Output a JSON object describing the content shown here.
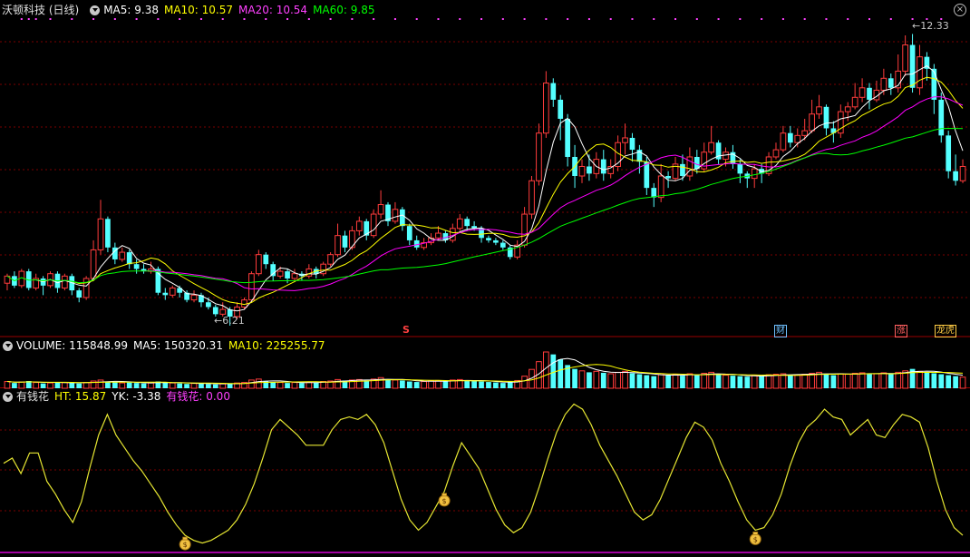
{
  "header": {
    "title": "沃顿科技 (日线)",
    "ma5_label": "MA5: 9.38",
    "ma10_label": "MA10: 10.57",
    "ma20_label": "MA20: 10.54",
    "ma60_label": "MA60: 9.85"
  },
  "volume_header": {
    "label": "VOLUME: 115848.99",
    "ma5_label": "MA5: 150320.31",
    "ma10_label": "MA10: 225255.77"
  },
  "indicator_header": {
    "title": "有钱花",
    "ht_label": "HT: 15.87",
    "yk_label": "YK: -3.38",
    "yqh_label": "有钱花: 0.00"
  },
  "annotations": {
    "high_label": "12.33",
    "low_label": "6.21",
    "badge_cai": "财",
    "badge_zhang": "涨",
    "badge_longhu": "龙虎",
    "s_marker": "S"
  },
  "colors": {
    "up": "#ff3c3c",
    "down": "#54ffff",
    "ma5": "#ffffff",
    "ma10": "#ffff00",
    "ma20": "#ff00ff",
    "ma60": "#00ff00",
    "grid": "#7a0000",
    "indicator": "#e6e632"
  },
  "chart_data": [
    {
      "type": "candlestick",
      "price_range": [
        6.0,
        12.7
      ],
      "candles": [
        [
          7.1,
          7.25,
          7.3,
          6.95
        ],
        [
          7.25,
          7.05,
          7.35,
          7.0
        ],
        [
          7.05,
          7.35,
          7.4,
          7.0
        ],
        [
          7.35,
          7.0,
          7.4,
          6.95
        ],
        [
          7.0,
          7.2,
          7.3,
          6.95
        ],
        [
          7.2,
          7.05,
          7.25,
          6.85
        ],
        [
          7.05,
          7.3,
          7.35,
          7.0
        ],
        [
          7.3,
          7.0,
          7.35,
          6.9
        ],
        [
          7.0,
          7.25,
          7.3,
          6.95
        ],
        [
          7.25,
          6.95,
          7.3,
          6.85
        ],
        [
          6.95,
          6.8,
          7.0,
          6.7
        ],
        [
          6.8,
          7.2,
          7.25,
          6.75
        ],
        [
          7.2,
          7.8,
          8.0,
          7.15
        ],
        [
          7.8,
          8.45,
          8.85,
          7.7
        ],
        [
          8.45,
          7.85,
          8.5,
          7.75
        ],
        [
          7.85,
          7.6,
          7.95,
          7.5
        ],
        [
          7.6,
          7.75,
          7.85,
          7.55
        ],
        [
          7.75,
          7.5,
          7.8,
          7.4
        ],
        [
          7.5,
          7.4,
          7.6,
          7.3
        ],
        [
          7.4,
          7.35,
          7.5,
          7.3
        ],
        [
          7.35,
          7.4,
          7.55,
          7.3
        ],
        [
          7.4,
          6.9,
          7.45,
          6.85
        ],
        [
          6.9,
          6.85,
          7.0,
          6.75
        ],
        [
          6.85,
          7.0,
          7.05,
          6.8
        ],
        [
          7.0,
          6.9,
          7.05,
          6.8
        ],
        [
          6.9,
          6.75,
          6.95,
          6.7
        ],
        [
          6.75,
          6.85,
          6.95,
          6.7
        ],
        [
          6.85,
          6.7,
          6.9,
          6.6
        ],
        [
          6.7,
          6.6,
          6.8,
          6.55
        ],
        [
          6.6,
          6.45,
          6.65,
          6.4
        ],
        [
          6.45,
          6.55,
          6.7,
          6.4
        ],
        [
          6.55,
          6.4,
          6.6,
          6.21
        ],
        [
          6.4,
          6.6,
          6.7,
          6.35
        ],
        [
          6.6,
          6.75,
          6.8,
          6.55
        ],
        [
          6.75,
          7.3,
          7.35,
          6.7
        ],
        [
          7.3,
          7.7,
          7.8,
          7.25
        ],
        [
          7.7,
          7.5,
          7.75,
          7.4
        ],
        [
          7.5,
          7.25,
          7.55,
          7.15
        ],
        [
          7.25,
          7.35,
          7.45,
          7.2
        ],
        [
          7.35,
          7.2,
          7.4,
          7.1
        ],
        [
          7.2,
          7.3,
          7.4,
          7.15
        ],
        [
          7.3,
          7.25,
          7.35,
          7.15
        ],
        [
          7.25,
          7.4,
          7.5,
          7.2
        ],
        [
          7.4,
          7.3,
          7.45,
          7.2
        ],
        [
          7.3,
          7.5,
          7.55,
          7.25
        ],
        [
          7.5,
          7.7,
          7.75,
          7.45
        ],
        [
          7.7,
          8.1,
          8.35,
          7.65
        ],
        [
          8.1,
          7.85,
          8.2,
          7.75
        ],
        [
          7.85,
          8.2,
          8.3,
          7.8
        ],
        [
          8.2,
          8.4,
          8.5,
          8.1
        ],
        [
          8.4,
          8.1,
          8.45,
          8.0
        ],
        [
          8.1,
          8.55,
          8.65,
          8.05
        ],
        [
          8.55,
          8.75,
          9.05,
          8.45
        ],
        [
          8.75,
          8.4,
          8.8,
          8.3
        ],
        [
          8.4,
          8.65,
          8.8,
          8.35
        ],
        [
          8.65,
          8.3,
          8.7,
          8.2
        ],
        [
          8.3,
          8.0,
          8.35,
          7.9
        ],
        [
          8.0,
          7.85,
          8.1,
          7.8
        ],
        [
          7.85,
          7.95,
          8.05,
          7.8
        ],
        [
          7.95,
          8.05,
          8.15,
          7.9
        ],
        [
          8.05,
          8.15,
          8.3,
          8.0
        ],
        [
          8.15,
          8.0,
          8.2,
          7.95
        ],
        [
          8.0,
          8.25,
          8.35,
          7.95
        ],
        [
          8.25,
          8.45,
          8.55,
          8.2
        ],
        [
          8.45,
          8.3,
          8.5,
          8.2
        ],
        [
          8.3,
          8.25,
          8.4,
          8.2
        ],
        [
          8.25,
          8.05,
          8.3,
          7.95
        ],
        [
          8.05,
          8.0,
          8.1,
          7.95
        ],
        [
          8.0,
          7.95,
          8.05,
          7.9
        ],
        [
          7.95,
          7.85,
          8.0,
          7.8
        ],
        [
          7.85,
          7.65,
          7.9,
          7.6
        ],
        [
          7.65,
          7.9,
          8.0,
          7.6
        ],
        [
          7.9,
          8.55,
          8.7,
          7.85
        ],
        [
          8.55,
          9.25,
          9.35,
          8.45
        ],
        [
          9.25,
          10.25,
          10.45,
          9.15
        ],
        [
          10.25,
          11.3,
          11.55,
          10.15
        ],
        [
          11.3,
          10.95,
          11.4,
          10.8
        ],
        [
          10.95,
          10.55,
          11.05,
          10.1
        ],
        [
          10.55,
          9.75,
          10.65,
          9.55
        ],
        [
          9.75,
          9.35,
          10.0,
          9.1
        ],
        [
          9.35,
          9.55,
          9.7,
          9.2
        ],
        [
          9.55,
          9.4,
          9.8,
          9.25
        ],
        [
          9.4,
          9.7,
          9.85,
          9.3
        ],
        [
          9.7,
          9.4,
          9.9,
          9.25
        ],
        [
          9.4,
          9.55,
          9.7,
          9.3
        ],
        [
          9.55,
          10.05,
          10.2,
          9.45
        ],
        [
          10.05,
          10.15,
          10.45,
          9.8
        ],
        [
          10.15,
          9.9,
          10.25,
          9.65
        ],
        [
          9.9,
          9.65,
          10.0,
          9.4
        ],
        [
          9.65,
          9.1,
          9.75,
          8.95
        ],
        [
          9.1,
          8.9,
          9.2,
          8.7
        ],
        [
          8.9,
          9.35,
          9.6,
          8.8
        ],
        [
          9.35,
          9.3,
          9.45,
          9.1
        ],
        [
          9.3,
          9.6,
          9.75,
          9.25
        ],
        [
          9.6,
          9.35,
          9.8,
          9.25
        ],
        [
          9.35,
          9.75,
          9.95,
          9.25
        ],
        [
          9.75,
          9.5,
          9.9,
          9.4
        ],
        [
          9.5,
          9.85,
          10.05,
          9.45
        ],
        [
          9.85,
          10.05,
          10.4,
          9.8
        ],
        [
          10.05,
          9.7,
          10.1,
          9.6
        ],
        [
          9.7,
          9.85,
          9.95,
          9.55
        ],
        [
          9.85,
          9.6,
          10.0,
          9.5
        ],
        [
          9.6,
          9.4,
          9.7,
          9.2
        ],
        [
          9.4,
          9.3,
          9.45,
          9.1
        ],
        [
          9.3,
          9.5,
          9.6,
          9.1
        ],
        [
          9.5,
          9.4,
          9.6,
          9.2
        ],
        [
          9.4,
          9.75,
          9.85,
          9.35
        ],
        [
          9.75,
          9.9,
          10.05,
          9.7
        ],
        [
          9.9,
          10.25,
          10.4,
          9.85
        ],
        [
          10.25,
          10.05,
          10.4,
          9.95
        ],
        [
          10.05,
          10.2,
          10.35,
          9.95
        ],
        [
          10.2,
          10.3,
          10.55,
          10.1
        ],
        [
          10.3,
          10.65,
          10.95,
          10.25
        ],
        [
          10.65,
          10.8,
          11.05,
          10.55
        ],
        [
          10.8,
          10.35,
          10.85,
          10.2
        ],
        [
          10.35,
          10.25,
          10.5,
          10.05
        ],
        [
          10.25,
          10.7,
          10.85,
          10.15
        ],
        [
          10.7,
          10.8,
          10.9,
          10.5
        ],
        [
          10.8,
          11.0,
          11.3,
          10.75
        ],
        [
          11.0,
          11.2,
          11.4,
          10.9
        ],
        [
          11.2,
          10.95,
          11.3,
          10.75
        ],
        [
          10.95,
          11.15,
          11.35,
          10.9
        ],
        [
          11.15,
          11.4,
          11.6,
          11.05
        ],
        [
          11.4,
          11.2,
          11.5,
          11.05
        ],
        [
          11.2,
          11.55,
          11.9,
          11.1
        ],
        [
          11.55,
          12.1,
          12.3,
          11.45
        ],
        [
          12.1,
          11.2,
          12.33,
          11.1
        ],
        [
          11.2,
          11.85,
          12.1,
          11.05
        ],
        [
          11.85,
          11.6,
          11.95,
          11.35
        ],
        [
          11.6,
          10.95,
          11.7,
          10.65
        ],
        [
          10.95,
          10.2,
          11.1,
          10.05
        ],
        [
          10.2,
          9.45,
          10.3,
          9.3
        ],
        [
          9.45,
          9.25,
          9.8,
          9.15
        ],
        [
          9.25,
          9.55,
          9.7,
          9.2
        ]
      ]
    },
    {
      "type": "bar",
      "title": "VOLUME",
      "values": [
        28,
        22,
        26,
        30,
        24,
        20,
        22,
        26,
        24,
        22,
        20,
        24,
        30,
        34,
        28,
        26,
        22,
        24,
        22,
        20,
        22,
        28,
        24,
        22,
        20,
        18,
        20,
        22,
        18,
        16,
        18,
        20,
        22,
        24,
        34,
        38,
        30,
        26,
        24,
        22,
        24,
        22,
        26,
        24,
        28,
        30,
        36,
        32,
        34,
        36,
        32,
        38,
        44,
        36,
        34,
        32,
        28,
        26,
        28,
        30,
        32,
        28,
        34,
        36,
        32,
        30,
        28,
        26,
        24,
        22,
        26,
        32,
        50,
        78,
        110,
        150,
        140,
        120,
        96,
        80,
        72,
        66,
        70,
        64,
        60,
        66,
        70,
        62,
        58,
        54,
        50,
        56,
        54,
        58,
        52,
        60,
        54,
        62,
        66,
        56,
        54,
        52,
        50,
        48,
        52,
        50,
        56,
        58,
        60,
        56,
        54,
        58,
        62,
        66,
        58,
        54,
        60,
        58,
        62,
        64,
        58,
        60,
        64,
        60,
        66,
        72,
        80,
        70,
        66,
        62,
        58,
        54,
        50,
        46
      ],
      "ma5_label": "MA5: 150320.31"
    },
    {
      "type": "line",
      "title": "有钱花",
      "range": [
        -5,
        105
      ],
      "values": [
        58,
        62,
        50,
        66,
        66,
        44,
        34,
        22,
        12,
        28,
        55,
        80,
        96,
        80,
        70,
        60,
        52,
        42,
        32,
        20,
        10,
        2,
        -2,
        -4,
        -2,
        2,
        6,
        14,
        26,
        42,
        62,
        84,
        92,
        86,
        80,
        72,
        72,
        72,
        84,
        92,
        94,
        92,
        96,
        88,
        74,
        52,
        30,
        14,
        6,
        12,
        24,
        36,
        56,
        74,
        64,
        54,
        38,
        22,
        10,
        4,
        8,
        20,
        40,
        62,
        82,
        96,
        104,
        100,
        88,
        72,
        60,
        48,
        34,
        20,
        14,
        18,
        30,
        46,
        62,
        78,
        90,
        86,
        76,
        58,
        44,
        28,
        14,
        6,
        8,
        18,
        34,
        56,
        74,
        86,
        92,
        100,
        94,
        92,
        80,
        86,
        92,
        80,
        78,
        88,
        96,
        94,
        90,
        70,
        44,
        22,
        8,
        2
      ],
      "buy_markers": [
        21,
        51,
        87
      ]
    }
  ]
}
